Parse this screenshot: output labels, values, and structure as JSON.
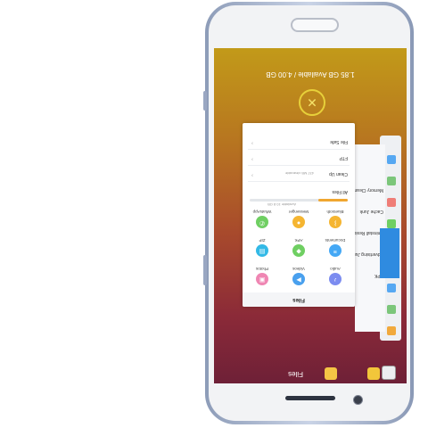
{
  "memory": "1.85 GB Available / 4.00 GB",
  "close_icon": "close-icon",
  "card": {
    "title": "Files",
    "app_label": "Files",
    "grid": [
      {
        "label": "Audio",
        "icon_color": "#7c8cf0"
      },
      {
        "label": "Videos",
        "icon_color": "#49a0ee"
      },
      {
        "label": "Photos",
        "icon_color": "#ef86b3"
      },
      {
        "label": "Documents",
        "icon_color": "#45a8f5"
      },
      {
        "label": "APK",
        "icon_color": "#6fcf62"
      },
      {
        "label": "ZIP",
        "icon_color": "#33b9e6"
      },
      {
        "label": "Bluetooth",
        "icon_color": "#f5b531"
      },
      {
        "label": "Messenger",
        "icon_color": "#f5b531"
      },
      {
        "label": "WhatsApp",
        "icon_color": "#6fcf62"
      }
    ],
    "storage_label": "All Files",
    "storage_value": "Available 10.8 GB",
    "storage_fraction": 0.3,
    "rows": [
      {
        "label": "Clean Up",
        "note": "437 MB cleanable"
      },
      {
        "label": "FTP",
        "note": ""
      },
      {
        "label": "File Safe",
        "note": ""
      }
    ]
  },
  "back_card": {
    "items": [
      "APK",
      "Advertising Junk",
      "Uninstall Residues",
      "Cache Junk",
      "Memory Clean"
    ]
  }
}
